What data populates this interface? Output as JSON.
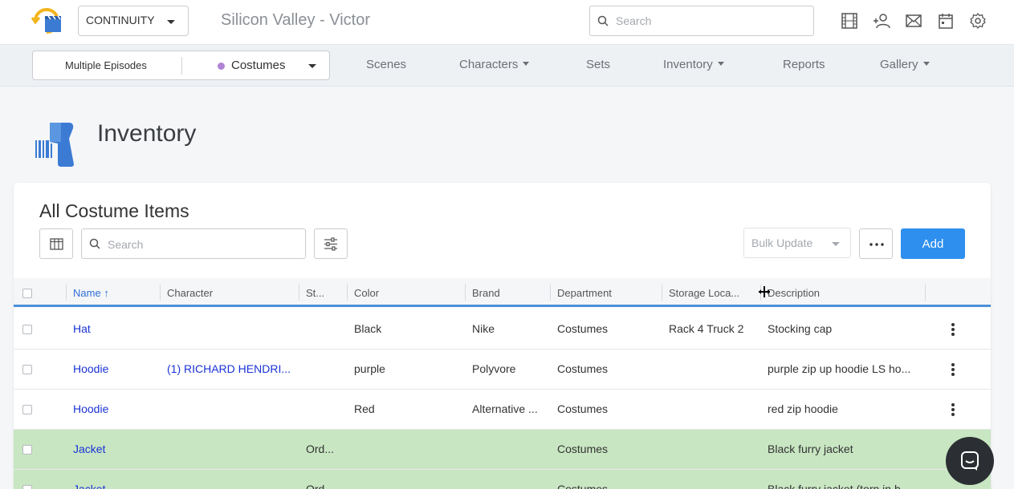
{
  "header": {
    "project_select": "CONTINUITY",
    "production_title": "Silicon Valley - Victor",
    "search_placeholder": "Search",
    "icons": [
      "film-icon",
      "add-user-icon",
      "mail-icon",
      "calendar-icon",
      "settings-icon"
    ]
  },
  "nav": {
    "episodes_label": "Multiple Episodes",
    "department_label": "Costumes",
    "department_color": "#b084d4",
    "items": [
      "Scenes",
      "Characters",
      "Sets",
      "Inventory",
      "Reports",
      "Gallery"
    ]
  },
  "page": {
    "title": "Inventory"
  },
  "card": {
    "title": "All Costume Items",
    "search_placeholder": "Search",
    "bulk_update_label": "Bulk Update",
    "add_label": "Add"
  },
  "table": {
    "columns": [
      "Name",
      "Character",
      "St...",
      "Color",
      "Brand",
      "Department",
      "Storage Loca...",
      "Description"
    ],
    "rows": [
      {
        "name": "Hat",
        "character": "",
        "status": "",
        "color": "Black",
        "brand": "Nike",
        "department": "Costumes",
        "storage": "Rack 4 Truck 2",
        "description": "Stocking cap"
      },
      {
        "name": "Hoodie",
        "character": "(1) RICHARD HENDRI...",
        "status": "",
        "color": "purple",
        "brand": "Polyvore",
        "department": "Costumes",
        "storage": "",
        "description": "purple zip up hoodie LS ho..."
      },
      {
        "name": "Hoodie",
        "character": "",
        "status": "",
        "color": "Red",
        "brand": "Alternative ...",
        "department": "Costumes",
        "storage": "",
        "description": "red zip hoodie"
      },
      {
        "name": "Jacket",
        "character": "",
        "status": "Ord...",
        "color": "",
        "brand": "",
        "department": "Costumes",
        "storage": "",
        "description": "Black furry jacket"
      },
      {
        "name": "Jacket",
        "character": "",
        "status": "Ord...",
        "color": "",
        "brand": "",
        "department": "Costumes",
        "storage": "",
        "description": "Black furry jacket (torn in b..."
      }
    ]
  },
  "colors": {
    "accent": "#2e8fef",
    "link": "#1a33d6",
    "highlight_row": "#c8e6c2"
  }
}
